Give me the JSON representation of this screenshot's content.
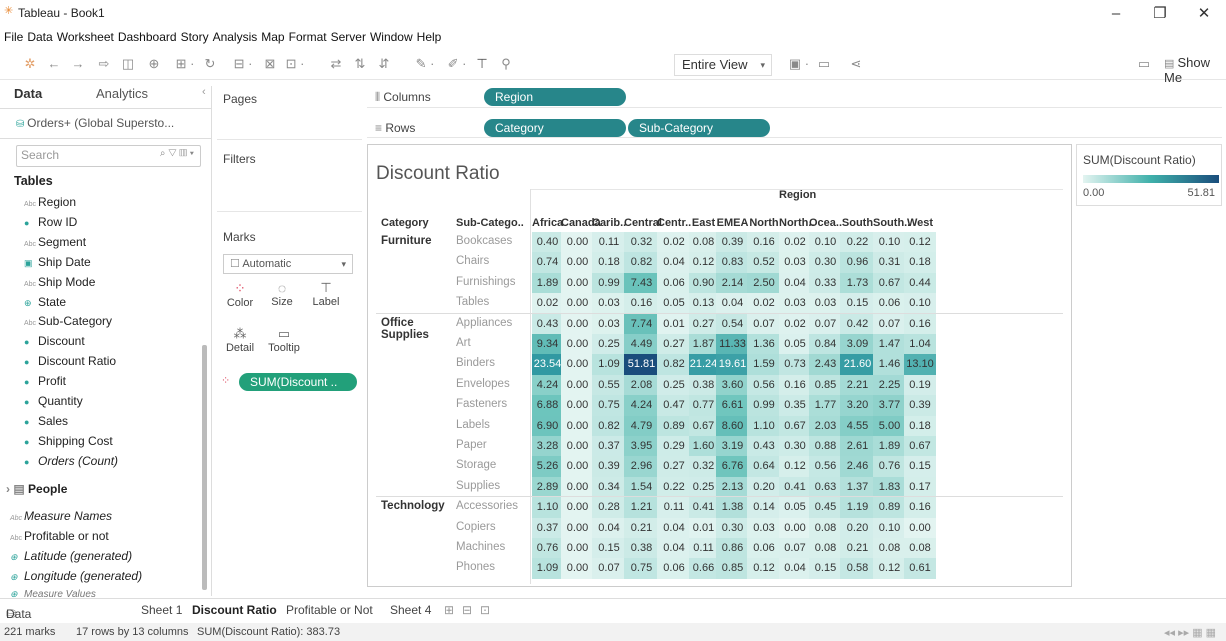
{
  "window": {
    "title": "Tableau - Book1"
  },
  "menu": [
    "File",
    "Data",
    "Worksheet",
    "Dashboard",
    "Story",
    "Analysis",
    "Map",
    "Format",
    "Server",
    "Window",
    "Help"
  ],
  "toolbar": {
    "view_mode": "Entire View",
    "show_me": "Show Me"
  },
  "data_pane": {
    "tab_data": "Data",
    "tab_analytics": "Analytics",
    "datasource": "Orders+ (Global Supersto...",
    "search_placeholder": "Search",
    "tables_heading": "Tables",
    "fields": [
      {
        "type": "abc",
        "label": "Region"
      },
      {
        "type": "m",
        "label": "Row ID"
      },
      {
        "type": "abc",
        "label": "Segment"
      },
      {
        "type": "date",
        "label": "Ship Date"
      },
      {
        "type": "abc",
        "label": "Ship Mode"
      },
      {
        "type": "geo",
        "label": "State"
      },
      {
        "type": "abc",
        "label": "Sub-Category"
      },
      {
        "type": "m",
        "label": "Discount"
      },
      {
        "type": "m",
        "label": "Discount Ratio"
      },
      {
        "type": "m",
        "label": "Profit"
      },
      {
        "type": "m",
        "label": "Quantity"
      },
      {
        "type": "m",
        "label": "Sales"
      },
      {
        "type": "m",
        "label": "Shipping Cost"
      },
      {
        "type": "m",
        "label": "Orders (Count)"
      }
    ],
    "people": "People",
    "extra_fields": [
      "Measure Names",
      "Profitable or not",
      "Latitude (generated)",
      "Longitude (generated)",
      "Measure Values"
    ]
  },
  "cards": {
    "pages": "Pages",
    "filters": "Filters",
    "marks": "Marks",
    "mark_type": "Automatic",
    "color": "Color",
    "size": "Size",
    "label": "Label",
    "detail": "Detail",
    "tooltip": "Tooltip",
    "pill": "SUM(Discount .."
  },
  "shelves": {
    "columns_label": "Columns",
    "rows_label": "Rows",
    "columns": [
      "Region"
    ],
    "rows": [
      "Category",
      "Sub-Category"
    ]
  },
  "view": {
    "title": "Discount Ratio",
    "region_header": "Region",
    "category_header": "Category",
    "subcat_header": "Sub-Catego..",
    "regions": [
      "Africa",
      "Canada",
      "Carib..",
      "Central",
      "Centr..",
      "East",
      "EMEA",
      "North",
      "North..",
      "Ocea..",
      "South",
      "South..",
      "West"
    ],
    "categories": [
      {
        "name": "Furniture",
        "rows": [
          {
            "sub": "Bookcases",
            "v": [
              0.4,
              0.0,
              0.11,
              0.32,
              0.02,
              0.08,
              0.39,
              0.16,
              0.02,
              0.1,
              0.22,
              0.1,
              0.12
            ]
          },
          {
            "sub": "Chairs",
            "v": [
              0.74,
              0.0,
              0.18,
              0.82,
              0.04,
              0.12,
              0.83,
              0.52,
              0.03,
              0.3,
              0.96,
              0.31,
              0.18
            ]
          },
          {
            "sub": "Furnishings",
            "v": [
              1.89,
              0.0,
              0.99,
              7.43,
              0.06,
              0.9,
              2.14,
              2.5,
              0.04,
              0.33,
              1.73,
              0.67,
              0.44
            ]
          },
          {
            "sub": "Tables",
            "v": [
              0.02,
              0.0,
              0.03,
              0.16,
              0.05,
              0.13,
              0.04,
              0.02,
              0.03,
              0.03,
              0.15,
              0.06,
              0.1
            ]
          }
        ]
      },
      {
        "name": "Office Supplies",
        "rows": [
          {
            "sub": "Appliances",
            "v": [
              0.43,
              0.0,
              0.03,
              7.74,
              0.01,
              0.27,
              0.54,
              0.07,
              0.02,
              0.07,
              0.42,
              0.07,
              0.16
            ]
          },
          {
            "sub": "Art",
            "v": [
              9.34,
              0.0,
              0.25,
              4.49,
              0.27,
              1.87,
              11.33,
              1.36,
              0.05,
              0.84,
              3.09,
              1.47,
              1.04
            ]
          },
          {
            "sub": "Binders",
            "v": [
              23.54,
              0.0,
              1.09,
              51.81,
              0.82,
              21.24,
              19.61,
              1.59,
              0.73,
              2.43,
              21.6,
              1.46,
              13.1
            ]
          },
          {
            "sub": "Envelopes",
            "v": [
              4.24,
              0.0,
              0.55,
              2.08,
              0.25,
              0.38,
              3.6,
              0.56,
              0.16,
              0.85,
              2.21,
              2.25,
              0.19
            ]
          },
          {
            "sub": "Fasteners",
            "v": [
              6.88,
              0.0,
              0.75,
              4.24,
              0.47,
              0.77,
              6.61,
              0.99,
              0.35,
              1.77,
              3.2,
              3.77,
              0.39
            ]
          },
          {
            "sub": "Labels",
            "v": [
              6.9,
              0.0,
              0.82,
              4.79,
              0.89,
              0.67,
              8.6,
              1.1,
              0.67,
              2.03,
              4.55,
              5.0,
              0.18
            ]
          },
          {
            "sub": "Paper",
            "v": [
              3.28,
              0.0,
              0.37,
              3.95,
              0.29,
              1.6,
              3.19,
              0.43,
              0.3,
              0.88,
              2.61,
              1.89,
              0.67
            ]
          },
          {
            "sub": "Storage",
            "v": [
              5.26,
              0.0,
              0.39,
              2.96,
              0.27,
              0.32,
              6.76,
              0.64,
              0.12,
              0.56,
              2.46,
              0.76,
              0.15
            ]
          },
          {
            "sub": "Supplies",
            "v": [
              2.89,
              0.0,
              0.34,
              1.54,
              0.22,
              0.25,
              2.13,
              0.2,
              0.41,
              0.63,
              1.37,
              1.83,
              0.17
            ]
          }
        ]
      },
      {
        "name": "Technology",
        "rows": [
          {
            "sub": "Accessories",
            "v": [
              1.1,
              0.0,
              0.28,
              1.21,
              0.11,
              0.41,
              1.38,
              0.14,
              0.05,
              0.45,
              1.19,
              0.89,
              0.16
            ]
          },
          {
            "sub": "Copiers",
            "v": [
              0.37,
              0.0,
              0.04,
              0.21,
              0.04,
              0.01,
              0.3,
              0.03,
              0.0,
              0.08,
              0.2,
              0.1,
              0.0
            ]
          },
          {
            "sub": "Machines",
            "v": [
              0.76,
              0.0,
              0.15,
              0.38,
              0.04,
              0.11,
              0.86,
              0.06,
              0.07,
              0.08,
              0.21,
              0.08,
              0.08
            ]
          },
          {
            "sub": "Phones",
            "v": [
              1.09,
              0.0,
              0.07,
              0.75,
              0.06,
              0.66,
              0.85,
              0.12,
              0.04,
              0.15,
              0.58,
              0.12,
              0.61
            ]
          }
        ]
      }
    ]
  },
  "legend": {
    "title": "SUM(Discount Ratio)",
    "min": "0.00",
    "max": "51.81",
    "min_value": 0,
    "max_value": 51.81
  },
  "sheet_tabs": {
    "data_source": "Data Source",
    "tabs": [
      "Sheet 1",
      "Discount Ratio",
      "Profitable or Not",
      "Sheet 4"
    ],
    "active": "Discount Ratio"
  },
  "status": {
    "marks": "221 marks",
    "dims": "17 rows by 13 columns",
    "sum": "SUM(Discount Ratio): 383.73"
  }
}
